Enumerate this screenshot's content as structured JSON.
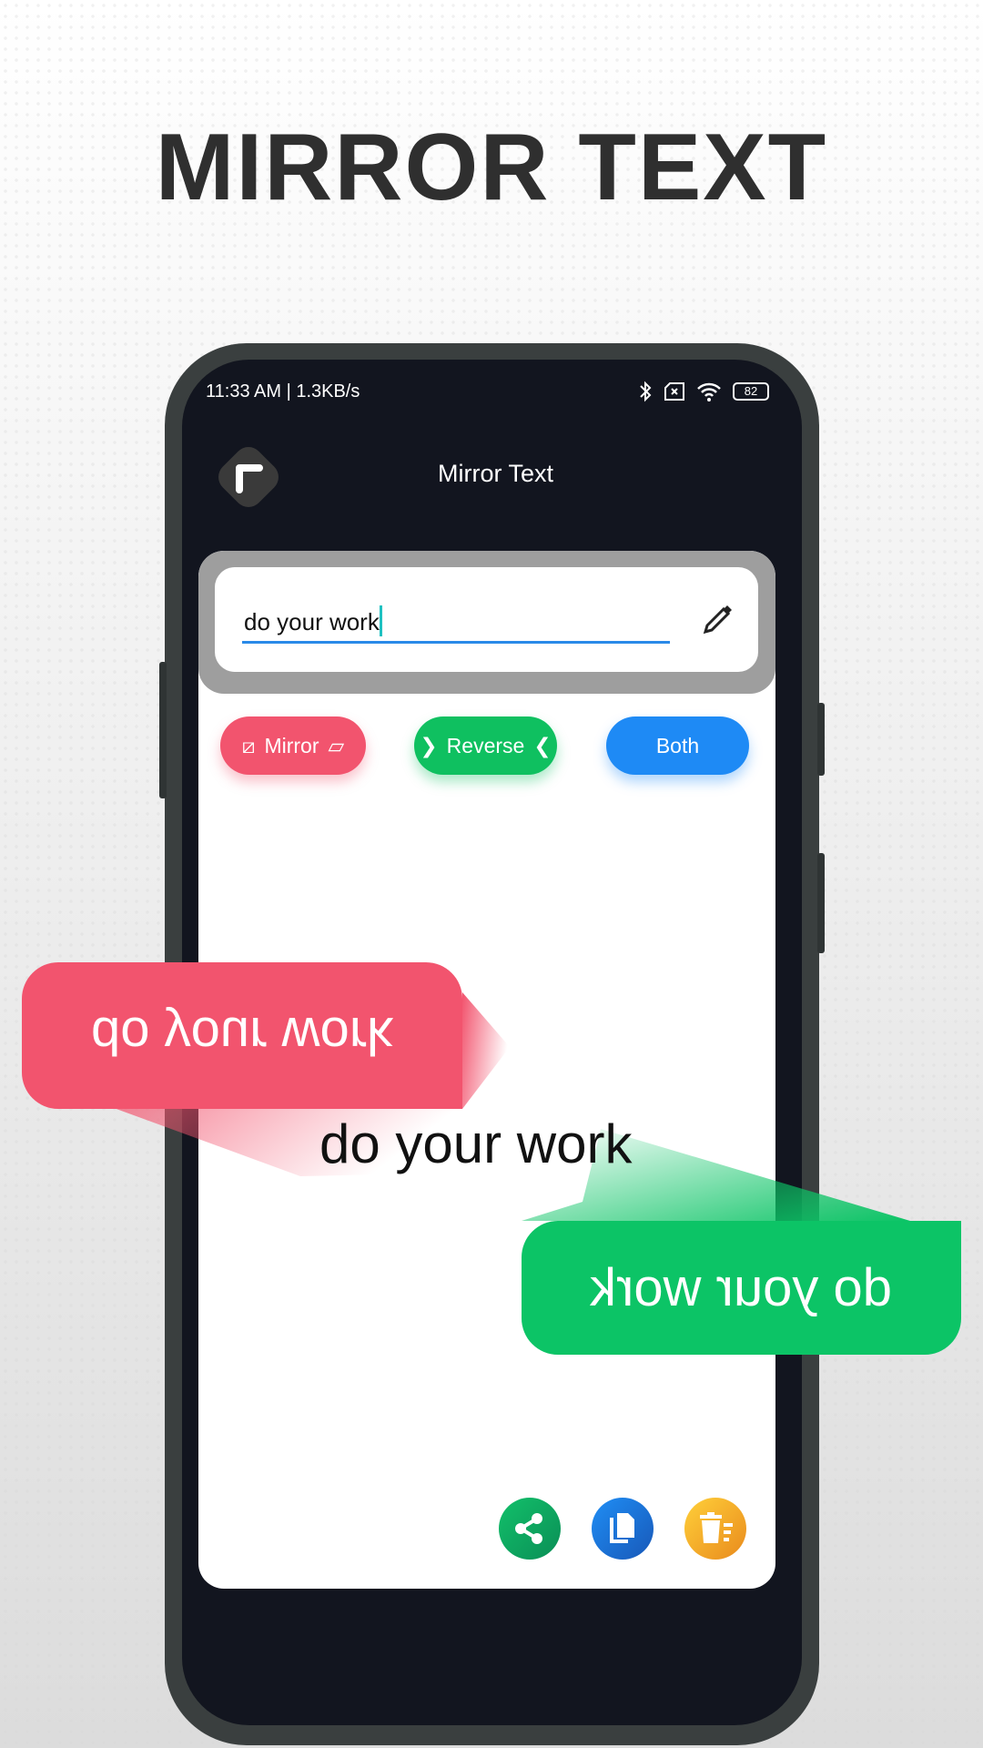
{
  "headline": "MIRROR TEXT",
  "status": {
    "time": "11:33 AM | 1.3KB/s",
    "battery": "82"
  },
  "app": {
    "title": "Mirror Text"
  },
  "input": {
    "value": "do your work"
  },
  "buttons": {
    "mirror": "Mirror",
    "reverse": "Reverse",
    "both": "Both"
  },
  "bubbles": {
    "mirrored": "do your work",
    "original": "do your work",
    "reversed": "do your work"
  },
  "actions": [
    "share-icon",
    "copy-icon",
    "clear-icon"
  ],
  "colors": {
    "red": "#f2546e",
    "green": "#0cc466",
    "blue": "#1e8af5",
    "dark": "#12151f"
  }
}
